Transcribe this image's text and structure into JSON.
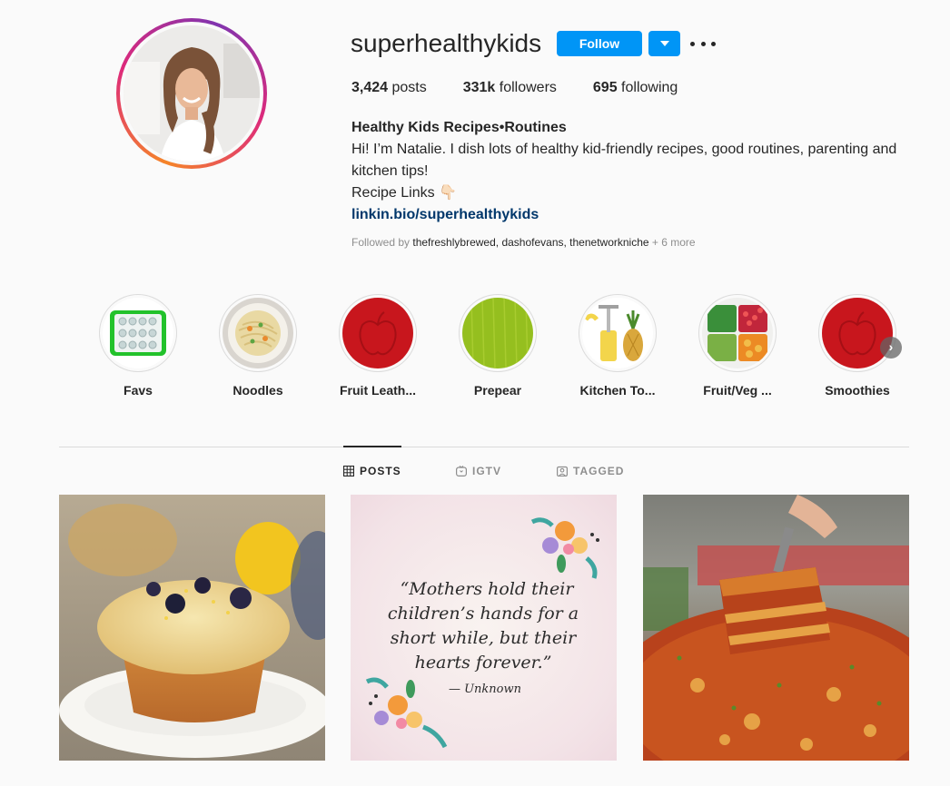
{
  "profile": {
    "username": "superhealthykids",
    "follow_label": "Follow",
    "stats": {
      "posts_count": "3,424",
      "posts_label": " posts",
      "followers_count": "331k",
      "followers_label": " followers",
      "following_count": "695",
      "following_label": " following"
    },
    "bio": {
      "name": "Healthy Kids Recipes•Routines",
      "line1": "Hi! I’m Natalie. I dish lots of healthy kid-friendly recipes, good routines, parenting and kitchen tips!",
      "line2": "Recipe Links 👇🏻",
      "link": "linkin.bio/superhealthykids"
    },
    "followed_by": {
      "prefix": "Followed by ",
      "users": [
        "thefreshlybrewed",
        "dashofevans",
        "thenetworkniche"
      ],
      "suffix": " + 6 more"
    }
  },
  "highlights": [
    {
      "label": "Favs",
      "icon": "muffin-tray-icon"
    },
    {
      "label": "Noodles",
      "icon": "noodle-bowl-icon"
    },
    {
      "label": "Fruit Leath...",
      "icon": "red-apple-icon"
    },
    {
      "label": "Prepear",
      "icon": "green-texture-icon"
    },
    {
      "label": "Kitchen To...",
      "icon": "pineapple-slicer-icon"
    },
    {
      "label": "Fruit/Veg ...",
      "icon": "veggie-containers-icon"
    },
    {
      "label": "Smoothies",
      "icon": "red-apple-icon"
    }
  ],
  "tabs": [
    {
      "label": "POSTS",
      "active": true
    },
    {
      "label": "IGTV",
      "active": false
    },
    {
      "label": "TAGGED",
      "active": false
    }
  ],
  "posts": [
    {
      "type": "photo",
      "subject": "blueberry-lemon-muffin"
    },
    {
      "type": "quote",
      "quote_line1": "“Mothers hold their",
      "quote_line2": "children’s hands for a",
      "quote_line3": "short while, but their",
      "quote_line4": "hearts forever.”",
      "attribution": "— Unknown"
    },
    {
      "type": "photo",
      "subject": "lasagna"
    }
  ],
  "colors": {
    "accent_blue": "#0095f6",
    "link_blue": "#00376b",
    "text_primary": "#262626",
    "text_secondary": "#8e8e8e",
    "background": "#fafafa"
  }
}
